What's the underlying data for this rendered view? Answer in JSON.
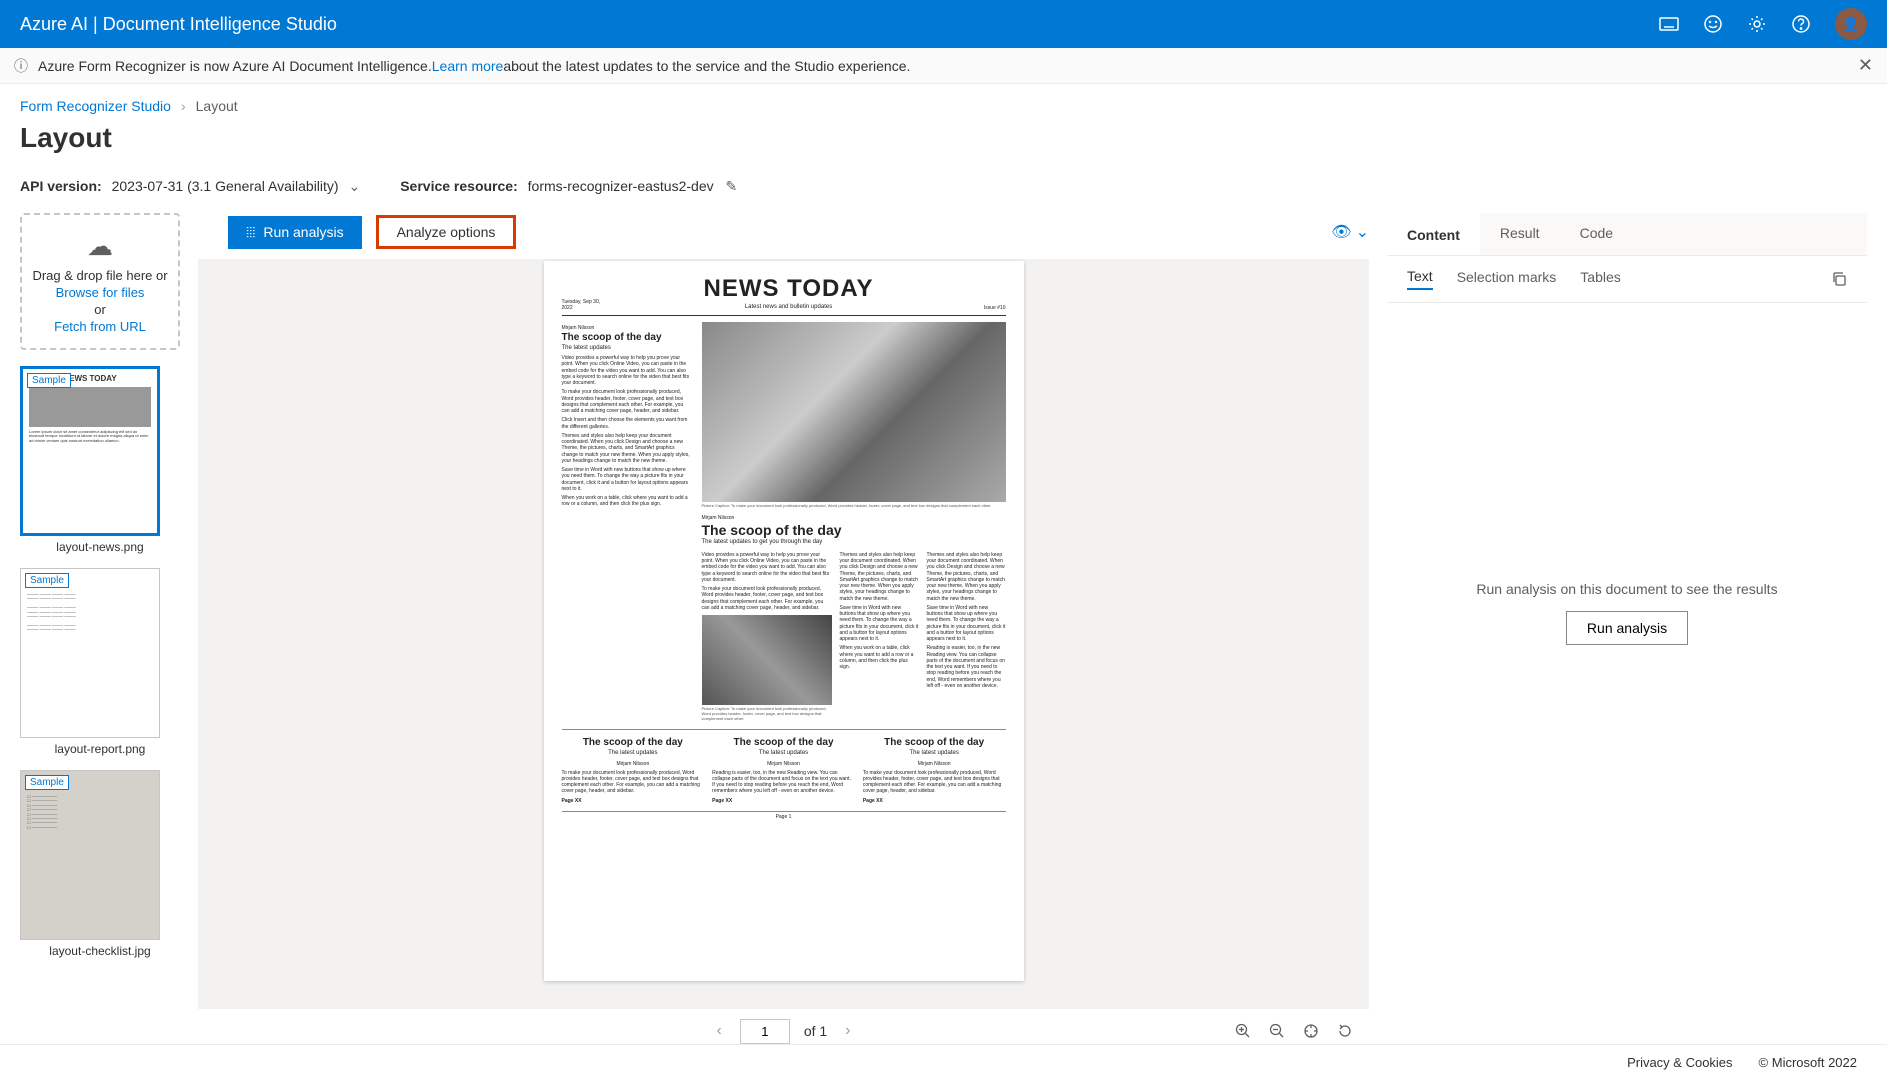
{
  "topbar": {
    "title": "Azure AI | Document Intelligence Studio"
  },
  "infobar": {
    "pre": "Azure Form Recognizer is now Azure AI Document Intelligence. ",
    "link": "Learn more",
    "post": " about the latest updates to the service and the Studio experience."
  },
  "breadcrumb": {
    "root": "Form Recognizer Studio",
    "current": "Layout"
  },
  "page_title": "Layout",
  "config": {
    "api_label": "API version:",
    "api_value": "2023-07-31 (3.1 General Availability)",
    "resource_label": "Service resource:",
    "resource_value": "forms-recognizer-eastus2-dev"
  },
  "dropzone": {
    "line1": "Drag & drop file here or",
    "browse": "Browse for files",
    "or": "or",
    "fetch": "Fetch from URL"
  },
  "thumbs": [
    {
      "name": "layout-news.png",
      "tag": "Sample",
      "selected": true
    },
    {
      "name": "layout-report.png",
      "tag": "Sample",
      "selected": false
    },
    {
      "name": "layout-checklist.jpg",
      "tag": "Sample",
      "selected": false
    }
  ],
  "toolbar": {
    "run": "Run analysis",
    "options": "Analyze options"
  },
  "document": {
    "masthead": {
      "date": "Tuesday, Sep 30, 2022",
      "title": "NEWS TODAY",
      "sub": "Latest news and bulletin updates",
      "issue": "Issue #10"
    },
    "byline": "Mirjam Nilsson",
    "h2": "The scoop of the day",
    "subh": "The latest updates",
    "subh2": "The latest updates to get you through the day",
    "body_short": "Video provides a powerful way to help you prove your point. When you click Online Video, you can paste in the embed code for the video you want to add. You can also type a keyword to search online for the video that best fits your document.",
    "body2": "To make your document look professionally produced, Word provides header, footer, cover page, and text box designs that complement each other. For example, you can add a matching cover page, header, and sidebar.",
    "body3": "Click Insert and then choose the elements you want from the different galleries.",
    "body4": "Themes and styles also help keep your document coordinated. When you click Design and choose a new Theme, the pictures, charts, and SmartArt graphics change to match your new theme. When you apply styles, your headings change to match the new theme.",
    "body5": "Save time in Word with new buttons that show up where you need them. To change the way a picture fits in your document, click it and a button for layout options appears next to it.",
    "body6": "When you work on a table, click where you want to add a row or a column, and then click the plus sign.",
    "body7": "Reading is easier, too, in the new Reading view. You can collapse parts of the document and focus on the text you want. If you need to stop reading before you reach the end, Word remembers where you left off - even on another device.",
    "caption": "Picture Caption: To make your document look professionally produced, Word provides header, footer, cover page, and text box designs that complement each other.",
    "page_label": "Page XX",
    "footer": "Page 1"
  },
  "docnav": {
    "page": "1",
    "of": "of 1"
  },
  "results": {
    "tabs1": [
      "Content",
      "Result",
      "Code"
    ],
    "tabs2": [
      "Text",
      "Selection marks",
      "Tables"
    ],
    "empty_msg": "Run analysis on this document to see the results",
    "run": "Run analysis"
  },
  "footer": {
    "privacy": "Privacy & Cookies",
    "copyright": "© Microsoft 2022"
  }
}
